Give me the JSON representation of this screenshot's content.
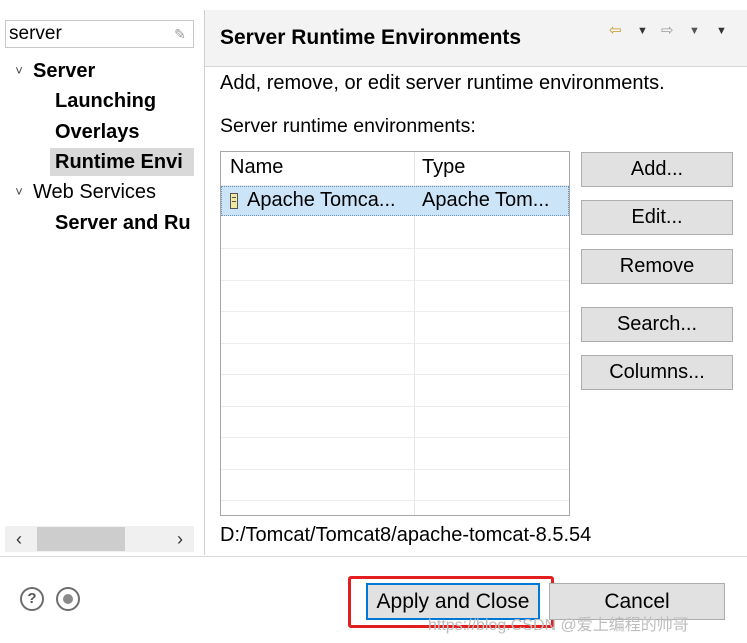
{
  "filter": {
    "value": "server",
    "clear_icon": "eraser-icon"
  },
  "tree": {
    "items": [
      {
        "label": "Server",
        "expanded": true,
        "bold": true
      },
      {
        "label": "Launching",
        "bold": true
      },
      {
        "label": "Overlays",
        "bold": true
      },
      {
        "label": "Runtime Envi",
        "bold": true,
        "selected": true
      },
      {
        "label": "Web Services",
        "expanded": true,
        "bold": false
      },
      {
        "label": "Server and Ru",
        "bold": true
      }
    ]
  },
  "scrollbar": {
    "left_arrow": "‹",
    "right_arrow": "›"
  },
  "header": {
    "title": "Server Runtime Environments",
    "nav_icons": [
      "back-arrow-icon",
      "dropdown-icon",
      "forward-arrow-icon",
      "dropdown-icon",
      "view-menu-icon"
    ]
  },
  "description": "Add, remove, or edit server runtime environments.",
  "env_label": "Server runtime environments:",
  "table": {
    "columns": [
      "Name",
      "Type"
    ],
    "rows": [
      {
        "name": "Apache Tomca...",
        "type": "Apache Tom...",
        "selected": true
      }
    ]
  },
  "buttons": {
    "add": "Add...",
    "edit": "Edit...",
    "remove": "Remove",
    "search": "Search...",
    "columns": "Columns..."
  },
  "selected_path": "D:/Tomcat/Tomcat8/apache-tomcat-8.5.54",
  "footer": {
    "help_icon": "help-icon",
    "prefs_icon": "preferences-icon",
    "apply_close": "Apply and Close",
    "cancel": "Cancel"
  },
  "watermark": "https://blog.CSDN @爱上编程的帅哥",
  "colors": {
    "selection": "#cce4f7",
    "highlight_box": "#e21e1e",
    "default_button_border": "#0078d7"
  }
}
